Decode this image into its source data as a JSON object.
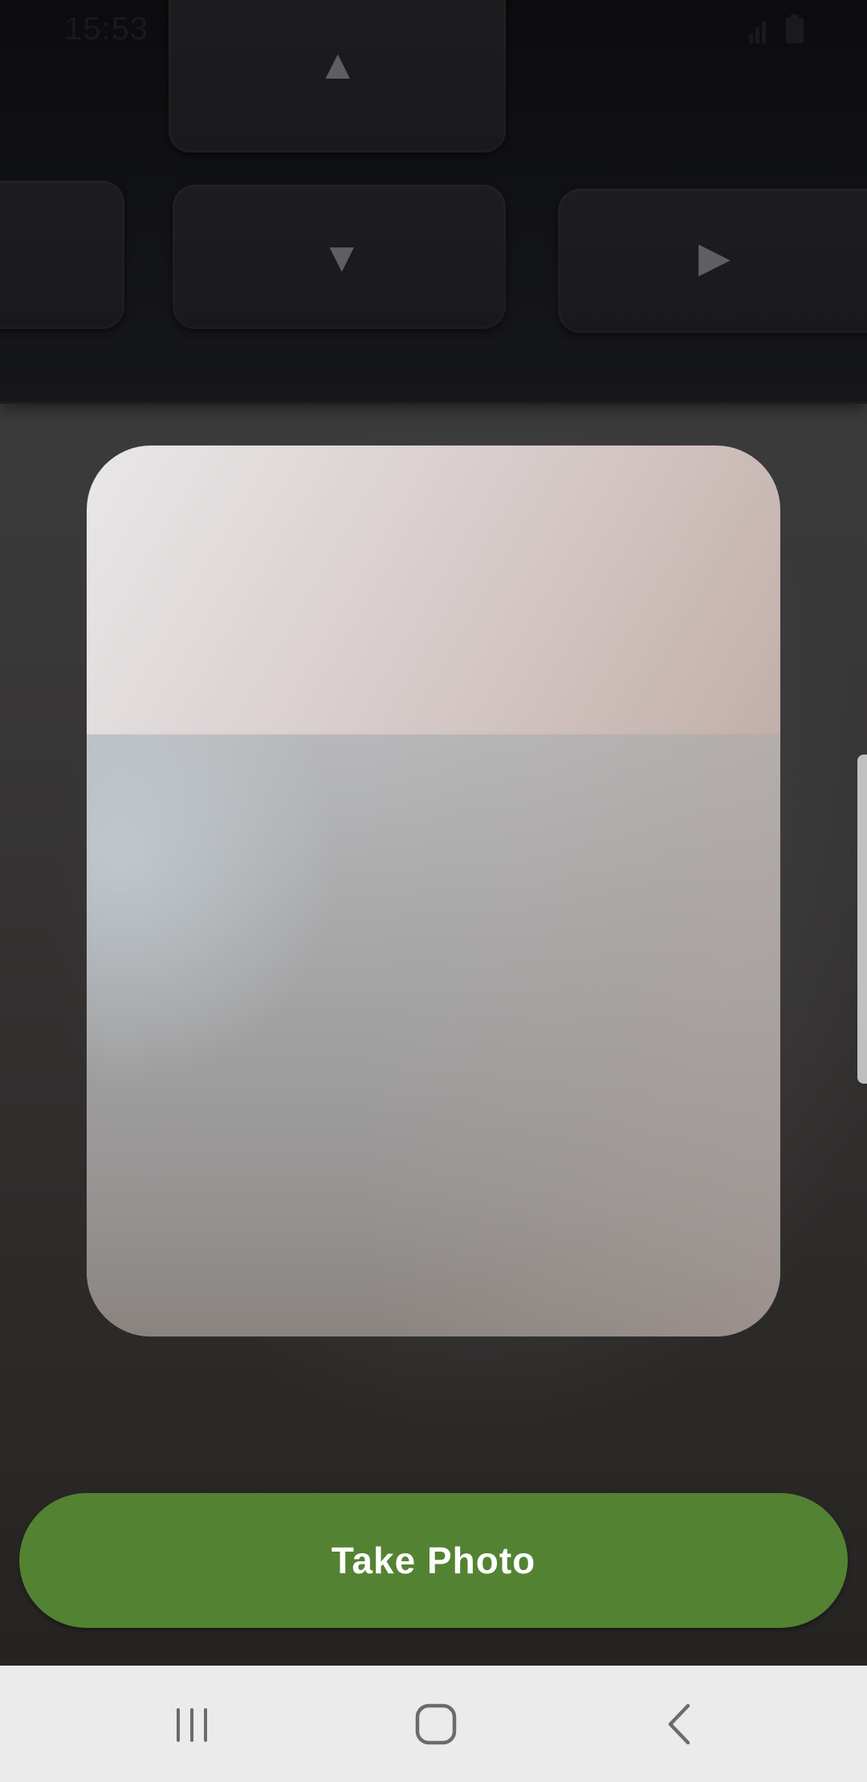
{
  "status_bar": {
    "time": "15:53",
    "signal_icon": "signal-icon",
    "battery_icon": "battery-icon"
  },
  "camera": {
    "keyboard_keys": [
      {
        "name": "key-left",
        "glyph": ""
      },
      {
        "name": "key-up",
        "glyph": "▲"
      },
      {
        "name": "key-down",
        "glyph": "▼"
      },
      {
        "name": "key-right",
        "glyph": "▶"
      }
    ]
  },
  "actions": {
    "take_photo_label": "Take Photo",
    "take_photo_color": "#538332"
  },
  "nav_bar": {
    "recent_icon": "recent-apps-icon",
    "home_icon": "home-icon",
    "back_icon": "back-icon"
  }
}
